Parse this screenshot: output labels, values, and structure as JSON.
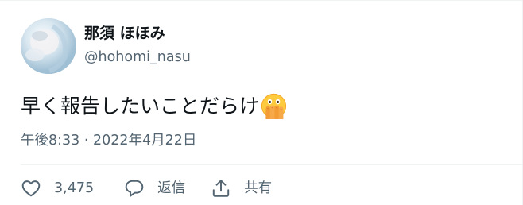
{
  "author": {
    "display_name": "那須 ほほみ",
    "handle": "@hohomi_nasu"
  },
  "tweet": {
    "text": "早く報告したいことだらけ",
    "emoji": "face-with-open-eyes-and-hand-over-mouth",
    "timestamp": "午後8:33 · 2022年4月22日"
  },
  "actions": {
    "like_count": "3,475",
    "reply_label": "返信",
    "share_label": "共有"
  },
  "colors": {
    "text": "#0f1419",
    "secondary": "#536471",
    "divider": "#eff3f4"
  }
}
